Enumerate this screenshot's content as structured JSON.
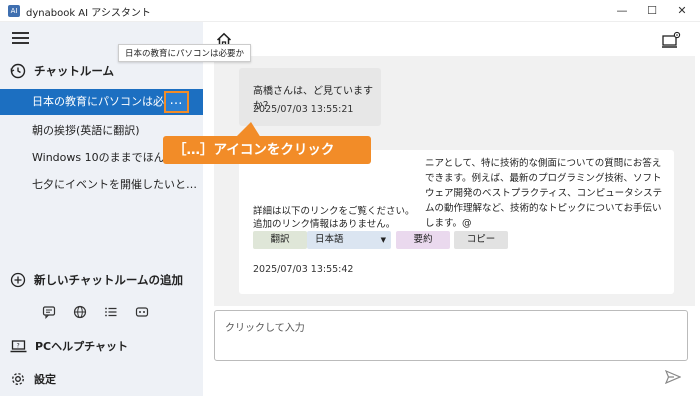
{
  "window": {
    "title": "dynabook AI アシスタント",
    "controls": {
      "minimize": "—",
      "maximize": "☐",
      "close": "✕"
    }
  },
  "sidebar": {
    "chat_rooms_label": "チャットルーム",
    "rooms": [
      {
        "label": "日本の教育にパソコンは必要か"
      },
      {
        "label": "朝の挨拶(英語に翻訳)"
      },
      {
        "label": "Windows 10のままでほんと…"
      },
      {
        "label": "七夕にイベントを開催したいと…"
      }
    ],
    "more_button_label": "…",
    "tooltip": "日本の教育にパソコンは必要か",
    "add_room_label": "新しいチャットルームの追加",
    "pc_help_label": "PCヘルプチャット",
    "settings_label": "設定"
  },
  "chat": {
    "user_message": {
      "text": "高橋さんは、ど見ていますか？",
      "timestamp": "2025/07/03 13:55:21"
    },
    "ai_message": {
      "text": "ニアとして、特に技術的な側面についての質問にお答えできます。例えば、最新のプログラミング技術、ソフトウェア開発のベストプラクティス、コンピュータシステムの動作理解など、技術的なトピックについてお手伝いします。@",
      "detail_line1": "詳細は以下のリンクをご覧ください。",
      "detail_line2": "追加のリンク情報はありません。",
      "translate_label": "翻訳",
      "language_value": "日本語",
      "summarize_label": "要約",
      "copy_label": "コピー",
      "timestamp": "2025/07/03 13:55:42"
    }
  },
  "callout": {
    "text": "［…］アイコンをクリック"
  },
  "input": {
    "placeholder": "クリックして入力"
  },
  "colors": {
    "accent": "#1c6fc1",
    "callout": "#f28c28",
    "sidebar_bg": "#eef1f6",
    "chat_bg": "#f1f1f1"
  }
}
